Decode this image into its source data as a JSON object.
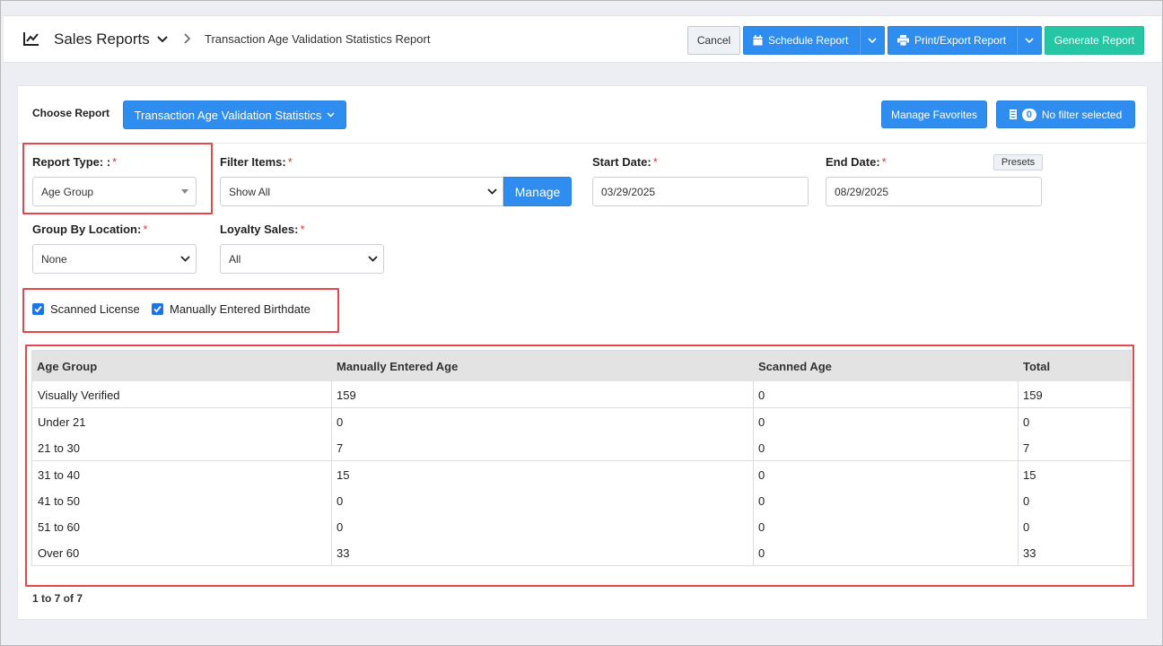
{
  "header": {
    "app_title": "Sales Reports",
    "breadcrumb": "Transaction Age Validation Statistics Report",
    "cancel_label": "Cancel",
    "schedule_label": "Schedule Report",
    "print_label": "Print/Export Report",
    "generate_label": "Generate Report",
    "icons": [
      "line-chart-icon",
      "chevron-down-icon",
      "chevron-right-icon",
      "calendar-icon",
      "printer-icon"
    ]
  },
  "report_bar": {
    "choose_label": "Choose Report",
    "selected_report": "Transaction Age Validation Statistics",
    "manage_favorites_label": "Manage Favorites",
    "filter_count": "0",
    "filter_label": "No filter selected"
  },
  "filters": {
    "report_type_label": "Report Type: :",
    "report_type_value": "Age Group",
    "filter_items_label": "Filter Items:",
    "filter_items_value": "Show All",
    "manage_label": "Manage",
    "start_date_label": "Start Date:",
    "start_date_value": "03/29/2025",
    "end_date_label": "End Date:",
    "end_date_value": "08/29/2025",
    "presets_label": "Presets",
    "group_by_label": "Group By Location:",
    "group_by_value": "None",
    "loyalty_label": "Loyalty Sales:",
    "loyalty_value": "All",
    "required_mark": "*"
  },
  "checkboxes": [
    {
      "label": "Scanned License",
      "checked": true
    },
    {
      "label": "Manually Entered Birthdate",
      "checked": true
    }
  ],
  "table": {
    "columns": [
      "Age Group",
      "Manually Entered Age",
      "Scanned Age",
      "Total"
    ],
    "rows": [
      [
        "Visually Verified",
        "159",
        "0",
        "159"
      ],
      [
        "Under 21",
        "0",
        "0",
        "0"
      ],
      [
        "21 to 30",
        "7",
        "0",
        "7"
      ],
      [
        "31 to 40",
        "15",
        "0",
        "15"
      ],
      [
        "41 to 50",
        "0",
        "0",
        "0"
      ],
      [
        "51 to 60",
        "0",
        "0",
        "0"
      ],
      [
        "Over 60",
        "33",
        "0",
        "33"
      ]
    ],
    "pager": "1 to 7 of 7"
  },
  "colors": {
    "primary_blue": "#2f8df0",
    "teal": "#24c6a4",
    "highlight_red": "#e5474a",
    "required_red": "#e0343b"
  }
}
